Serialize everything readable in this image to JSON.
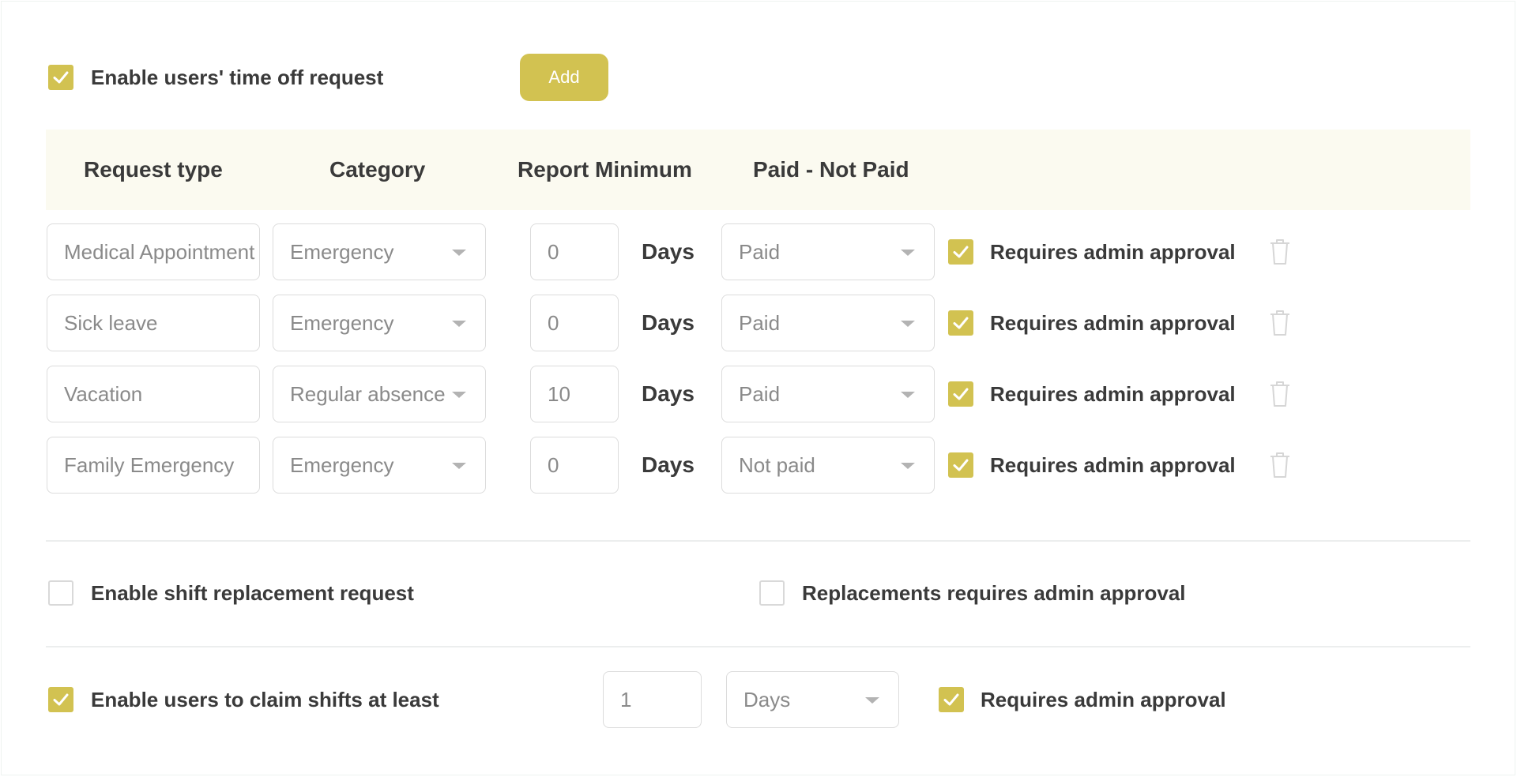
{
  "time_off": {
    "enable_label": "Enable users' time off request",
    "enabled": true,
    "add_label": "Add"
  },
  "table": {
    "headers": {
      "request_type": "Request type",
      "category": "Category",
      "report_minimum": "Report Minimum",
      "paid": "Paid - Not Paid"
    },
    "rows": [
      {
        "request_type": "Medical Appointment",
        "category": "Emergency",
        "min": "0",
        "unit": "Days",
        "paid": "Paid",
        "approval_label": "Requires admin approval",
        "approval": true
      },
      {
        "request_type": "Sick leave",
        "category": "Emergency",
        "min": "0",
        "unit": "Days",
        "paid": "Paid",
        "approval_label": "Requires admin approval",
        "approval": true
      },
      {
        "request_type": "Vacation",
        "category": "Regular absence",
        "min": "10",
        "unit": "Days",
        "paid": "Paid",
        "approval_label": "Requires admin approval",
        "approval": true
      },
      {
        "request_type": "Family Emergency",
        "category": "Emergency",
        "min": "0",
        "unit": "Days",
        "paid": "Not paid",
        "approval_label": "Requires admin approval",
        "approval": true
      }
    ]
  },
  "shift_replacement": {
    "enable_label": "Enable shift replacement request",
    "enabled": false,
    "approval_label": "Replacements requires admin approval",
    "approval": false
  },
  "claim_shifts": {
    "enable_label": "Enable users to claim shifts at least",
    "enabled": true,
    "amount": "1",
    "unit": "Days",
    "approval_label": "Requires admin approval",
    "approval": true
  },
  "colors": {
    "accent": "#d2c251",
    "header_bg": "#fbfaf0",
    "border": "#dcdcdc"
  },
  "icons": {
    "check": "check-icon",
    "dropdown": "chevron-down-icon",
    "delete": "trash-icon"
  }
}
